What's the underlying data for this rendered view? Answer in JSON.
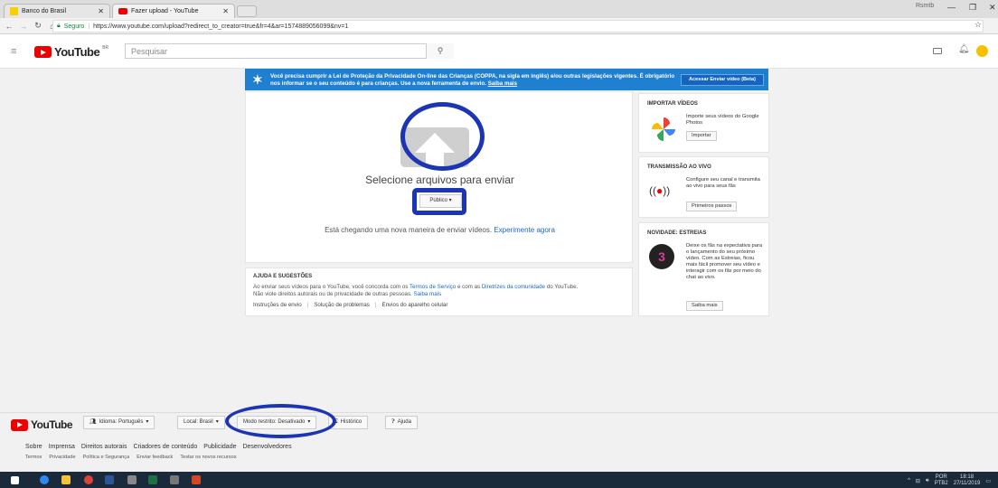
{
  "browser": {
    "tabs": [
      {
        "title": "Banco do Brasil"
      },
      {
        "title": "Fazer upload - YouTube"
      }
    ],
    "profile": "Rsmtb",
    "url_secure_label": "Seguro",
    "url": "https://www.youtube.com/upload?redirect_to_creator=true&fr=4&ar=1574889056099&nv=1"
  },
  "header": {
    "logo": "YouTube",
    "region": "BR",
    "search_placeholder": "Pesquisar"
  },
  "banner": {
    "message": "Você precisa cumprir a Lei de Proteção da Privacidade On-line das Crianças (COPPA, na sigla em inglês) e/ou outras legislações vigentes. É obrigatório nos informar se o seu conteúdo é para crianças. Use a nova ferramenta de envio.",
    "link": "Saiba mais",
    "button": "Acessar Enviar vídeo (Beta)"
  },
  "upload": {
    "title": "Selecione arquivos para enviar",
    "privacy": "Público",
    "new_way": "Está chegando uma nova maneira de enviar vídeos.",
    "try_link": "Experimente agora"
  },
  "help": {
    "heading": "AJUDA E SUGESTÕES",
    "text1": "Ao enviar seus vídeos para o YouTube, você concorda com os",
    "tos": "Termos de Serviço",
    "text2": "e com as",
    "guidelines": "Diretrizes da comunidade",
    "text3": "do YouTube.",
    "text4": "Não viole direitos autorais ou de privacidade de outras pessoas.",
    "more": "Saiba mais",
    "links": [
      "Instruções de envio",
      "Solução de problemas",
      "Envios do aparelho celular"
    ]
  },
  "side": {
    "import": {
      "heading": "IMPORTAR VÍDEOS",
      "text": "Importe seus vídeos do Google Photos",
      "button": "Importar"
    },
    "live": {
      "heading": "TRANSMISSÃO AO VIVO",
      "text": "Configure seu canal e transmita ao vivo para seus fãs",
      "button": "Primeiros passos"
    },
    "premiere": {
      "heading": "NOVIDADE: ESTREIAS",
      "text": "Deixe os fãs na expectativa para o lançamento do seu próximo vídeo. Com as Estreias, ficou mais fácil promover seu vídeo e interagir com os fãs por meio do chat ao vivo.",
      "button": "Saiba mais",
      "badge": "3"
    }
  },
  "footer": {
    "logo": "YouTube",
    "language": "Idioma: Português",
    "location": "Local: Brasil",
    "restricted": "Modo restrito: Desativado",
    "history": "Histórico",
    "help": "Ajuda",
    "links1": [
      "Sobre",
      "Imprensa",
      "Direitos autorais",
      "Criadores de conteúdo",
      "Publicidade",
      "Desenvolvedores"
    ],
    "links2": [
      "Termos",
      "Privacidade",
      "Política e Segurança",
      "Enviar feedback",
      "Testar os novos recursos"
    ]
  },
  "taskbar": {
    "lang": "POR",
    "layout": "PTB2",
    "time": "18:18",
    "date": "27/11/2019"
  },
  "colors": {
    "banner": "#1f7fd0",
    "annotation": "#1b35b5",
    "youtube_red": "#ee0000",
    "link": "#1a6ac5"
  }
}
